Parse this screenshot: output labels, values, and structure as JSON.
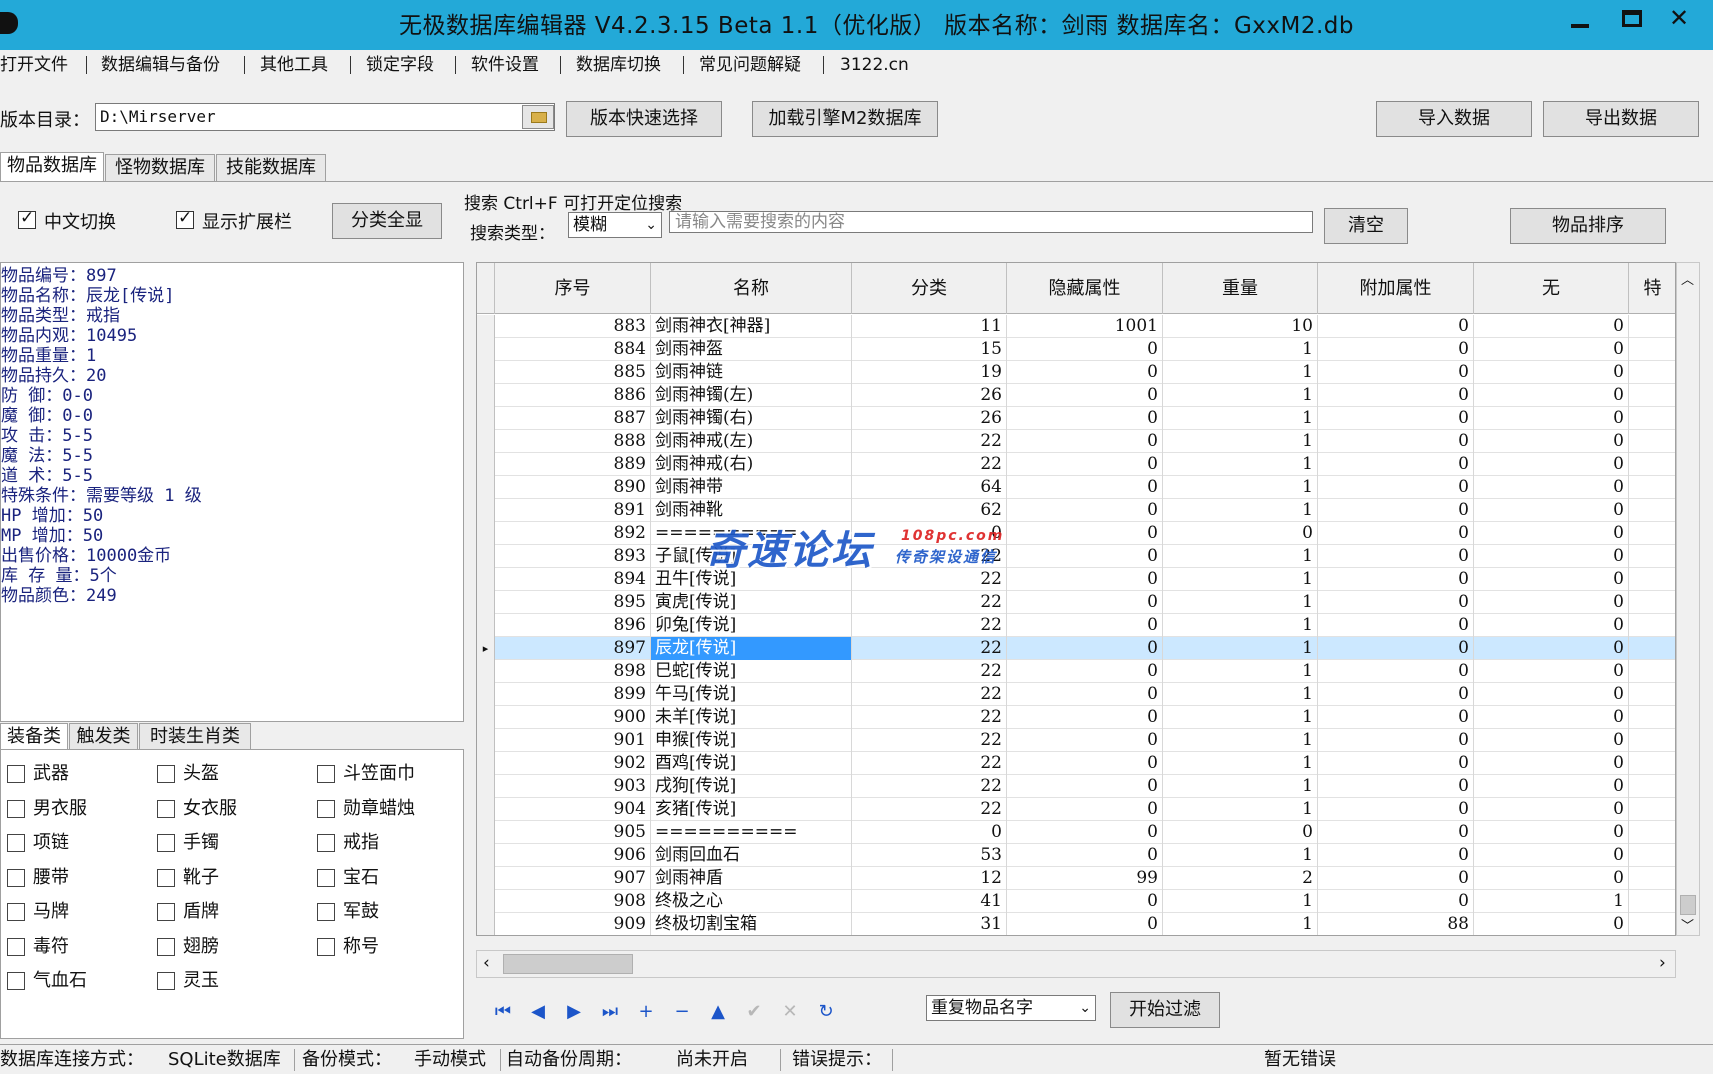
{
  "window": {
    "title": "无极数据库编辑器 V4.2.3.15    Beta 1.1（优化版）    版本名称：剑雨    数据库名：GxxM2.db",
    "close_glyph": "✕"
  },
  "menu": [
    "打开文件",
    "数据编辑与备份",
    "其他工具",
    "锁定字段",
    "软件设置",
    "数据库切换",
    "常见问题解疑",
    "3122.cn"
  ],
  "toolbar": {
    "dir_label": "版本目录：",
    "dir_value": "D:\\Mirserver",
    "quick_select": "版本快速选择",
    "load_engine": "加载引擎M2数据库",
    "import": "导入数据",
    "export": "导出数据"
  },
  "tabs": [
    "物品数据库",
    "怪物数据库",
    "技能数据库"
  ],
  "options": {
    "cn_switch": "中文切换",
    "show_ext": "显示扩展栏",
    "show_all": "分类全显",
    "search_title": "搜索   Ctrl+F 可打开定位搜索",
    "search_type_label": "搜索类型：",
    "search_type_value": "模糊",
    "search_placeholder": "请输入需要搜索的内容",
    "clear": "清空",
    "sort": "物品排序"
  },
  "item_info": [
    "物品编号：897",
    "物品名称：辰龙[传说]",
    "物品类型：戒指",
    "物品内观：10495",
    "物品重量：1",
    "物品持久：20",
    "防    御：0-0",
    "魔    御：0-0",
    "攻    击：5-5",
    "魔    法：5-5",
    "道    术：5-5",
    "特殊条件：需要等级 1 级",
    "HP  增加：50",
    "MP  增加：50",
    "出售价格：10000金币",
    "库 存 量：5个",
    "物品颜色：249"
  ],
  "category_tabs": [
    "装备类",
    "触发类",
    "时装生肖类"
  ],
  "categories": [
    [
      "武器",
      "头盔",
      "斗笠面巾"
    ],
    [
      "男衣服",
      "女衣服",
      "勋章蜡烛"
    ],
    [
      "项链",
      "手镯",
      "戒指"
    ],
    [
      "腰带",
      "靴子",
      "宝石"
    ],
    [
      "马牌",
      "盾牌",
      "军鼓"
    ],
    [
      "毒符",
      "翅膀",
      "称号"
    ],
    [
      "气血石",
      "灵玉",
      ""
    ]
  ],
  "grid": {
    "columns": [
      "序号",
      "名称",
      "分类",
      "隐藏属性",
      "重量",
      "附加属性",
      "无",
      "特"
    ],
    "selected_id": "897",
    "rows": [
      [
        "883",
        "剑雨神衣[神器]",
        "11",
        "1001",
        "10",
        "0",
        "0"
      ],
      [
        "884",
        "剑雨神盔",
        "15",
        "0",
        "1",
        "0",
        "0"
      ],
      [
        "885",
        "剑雨神链",
        "19",
        "0",
        "1",
        "0",
        "0"
      ],
      [
        "886",
        "剑雨神镯(左)",
        "26",
        "0",
        "1",
        "0",
        "0"
      ],
      [
        "887",
        "剑雨神镯(右)",
        "26",
        "0",
        "1",
        "0",
        "0"
      ],
      [
        "888",
        "剑雨神戒(左)",
        "22",
        "0",
        "1",
        "0",
        "0"
      ],
      [
        "889",
        "剑雨神戒(右)",
        "22",
        "0",
        "1",
        "0",
        "0"
      ],
      [
        "890",
        "剑雨神带",
        "64",
        "0",
        "1",
        "0",
        "0"
      ],
      [
        "891",
        "剑雨神靴",
        "62",
        "0",
        "1",
        "0",
        "0"
      ],
      [
        "892",
        "==========",
        "0",
        "0",
        "0",
        "0",
        "0"
      ],
      [
        "893",
        "子鼠[传说]",
        "22",
        "0",
        "1",
        "0",
        "0"
      ],
      [
        "894",
        "丑牛[传说]",
        "22",
        "0",
        "1",
        "0",
        "0"
      ],
      [
        "895",
        "寅虎[传说]",
        "22",
        "0",
        "1",
        "0",
        "0"
      ],
      [
        "896",
        "卯兔[传说]",
        "22",
        "0",
        "1",
        "0",
        "0"
      ],
      [
        "897",
        "辰龙[传说]",
        "22",
        "0",
        "1",
        "0",
        "0"
      ],
      [
        "898",
        "巳蛇[传说]",
        "22",
        "0",
        "1",
        "0",
        "0"
      ],
      [
        "899",
        "午马[传说]",
        "22",
        "0",
        "1",
        "0",
        "0"
      ],
      [
        "900",
        "未羊[传说]",
        "22",
        "0",
        "1",
        "0",
        "0"
      ],
      [
        "901",
        "申猴[传说]",
        "22",
        "0",
        "1",
        "0",
        "0"
      ],
      [
        "902",
        "酉鸡[传说]",
        "22",
        "0",
        "1",
        "0",
        "0"
      ],
      [
        "903",
        "戌狗[传说]",
        "22",
        "0",
        "1",
        "0",
        "0"
      ],
      [
        "904",
        "亥猪[传说]",
        "22",
        "0",
        "1",
        "0",
        "0"
      ],
      [
        "905",
        "==========",
        "0",
        "0",
        "0",
        "0",
        "0"
      ],
      [
        "906",
        "剑雨回血石",
        "53",
        "0",
        "1",
        "0",
        "0"
      ],
      [
        "907",
        "剑雨神盾",
        "12",
        "99",
        "2",
        "0",
        "0"
      ],
      [
        "908",
        "终极之心",
        "41",
        "0",
        "1",
        "0",
        "1"
      ],
      [
        "909",
        "终极切割宝箱",
        "31",
        "0",
        "1",
        "88",
        "0"
      ]
    ]
  },
  "watermark": {
    "main": "奇速论坛",
    "domain": "108pc.com",
    "sub": "传奇架设通信"
  },
  "filter": {
    "select_value": "重复物品名字",
    "start": "开始过滤"
  },
  "nav_icons": [
    "first-icon",
    "prev-icon",
    "next-icon",
    "last-icon",
    "add-icon",
    "delete-icon",
    "up-icon",
    "confirm-icon",
    "cancel-icon",
    "refresh-icon"
  ],
  "nav_glyphs": [
    "⏮",
    "◀",
    "▶",
    "⏭",
    "+",
    "−",
    "▲",
    "✔",
    "✕",
    "↻"
  ],
  "status": {
    "conn_label": "数据库连接方式：",
    "conn_value": "SQLite数据库",
    "backup_label": "备份模式：",
    "backup_value": "手动模式",
    "auto_label": "自动备份周期：",
    "auto_value": "尚未开启",
    "err_label": "错误提示：",
    "err_value": "暂无错误"
  },
  "colors": {
    "titlebar": "#23a9d8",
    "selection": "#3399ff",
    "selected_row": "#cce8ff",
    "info_text": "#1a237e",
    "nav_icon": "#1c55c9"
  }
}
